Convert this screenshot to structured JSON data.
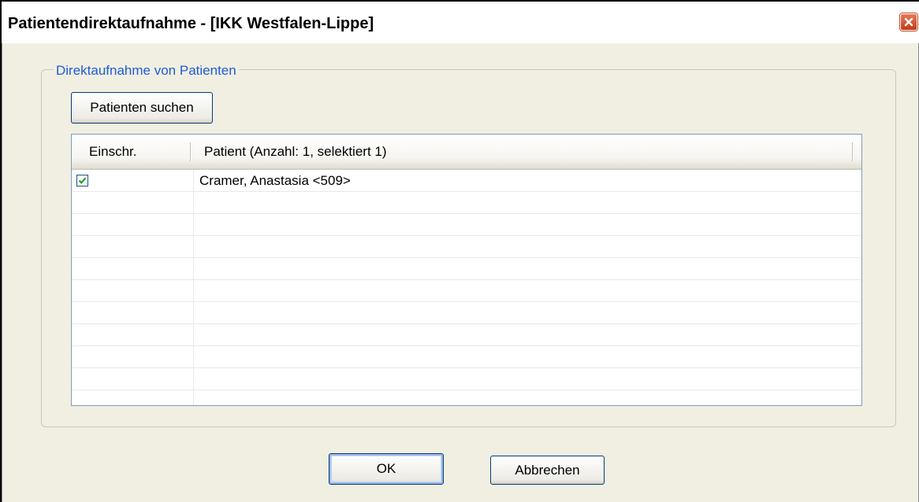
{
  "window": {
    "title": "Patientendirektaufnahme - [IKK Westfalen-Lippe]"
  },
  "group": {
    "legend": "Direktaufnahme von Patienten",
    "search_button": "Patienten suchen"
  },
  "list": {
    "columns": [
      "Einschr.",
      "Patient (Anzahl: 1, selektiert 1)"
    ],
    "rows": [
      {
        "checked": true,
        "patient": "Cramer,  Anastasia <509>"
      }
    ],
    "empty_rows": 10
  },
  "buttons": {
    "ok": "OK",
    "cancel": "Abbrechen"
  },
  "colors": {
    "legend_text": "#1d5bd6",
    "dialog_bg": "#f1efe2",
    "close_button": "#c23b17"
  },
  "icons": {
    "close": "close-icon",
    "checkbox": "checkmark-icon"
  }
}
